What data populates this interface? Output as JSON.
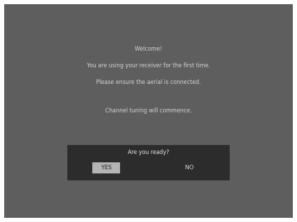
{
  "screen": {
    "background": "#5e5e5e",
    "lines": [
      "Welcome!",
      "You are using your receiver for the first time.",
      "Please ensure the aerial is connected."
    ],
    "commence": "Channel tuning will commence."
  },
  "dialog": {
    "question": "Are you ready?",
    "yes_label": "YES",
    "no_label": "NO",
    "selected": "YES"
  }
}
